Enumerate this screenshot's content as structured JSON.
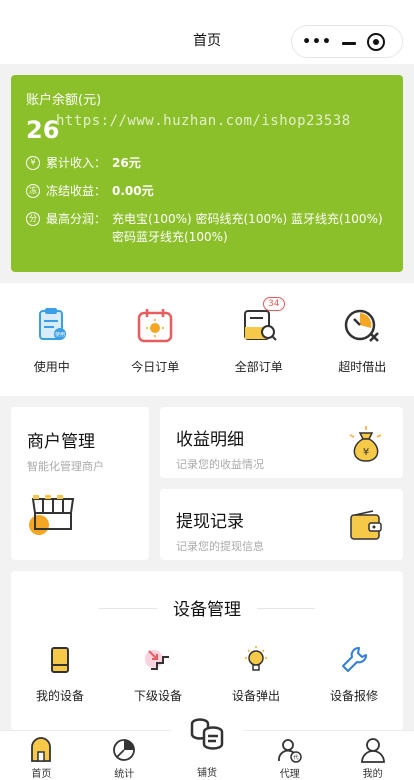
{
  "header": {
    "title": "首页"
  },
  "capsule": {
    "more_icon": "more-dots-icon",
    "minimize_icon": "minimize-icon",
    "close_icon": "target-close-icon"
  },
  "balance": {
    "label": "账户余额(元)",
    "amount": "26",
    "watermark": "https://www.huzhan.com/ishop23538",
    "rows": [
      {
        "icon": "yen-circle-icon",
        "key": "累计收入：",
        "value": "26元"
      },
      {
        "icon": "freeze-circle-icon",
        "key": "冻结收益：",
        "value": "0.00元"
      },
      {
        "icon": "share-circle-icon",
        "key": "最高分润：",
        "value": "充电宝(100%) 密码线充(100%) 蓝牙线充(100%) 密码蓝牙线充(100%)"
      }
    ],
    "color": "#8cc02a"
  },
  "orders": [
    {
      "label": "使用中",
      "icon": "clipboard-icon"
    },
    {
      "label": "今日订单",
      "icon": "calendar-icon"
    },
    {
      "label": "全部订单",
      "icon": "orders-search-icon",
      "badge": "34"
    },
    {
      "label": "超时借出",
      "icon": "clock-cancel-icon"
    }
  ],
  "merchant": {
    "title": "商户管理",
    "subtitle": "智能化管理商户",
    "icon": "shop-awning-icon"
  },
  "income": {
    "title": "收益明细",
    "subtitle": "记录您的收益情况",
    "icon": "money-bag-icon"
  },
  "withdraw": {
    "title": "提现记录",
    "subtitle": "记录您的提现信息",
    "icon": "wallet-icon"
  },
  "devices": {
    "title": "设备管理",
    "items": [
      {
        "label": "我的设备",
        "icon": "power-bank-icon"
      },
      {
        "label": "下级设备",
        "icon": "stairs-down-icon"
      },
      {
        "label": "设备弹出",
        "icon": "bulb-icon"
      },
      {
        "label": "设备报修",
        "icon": "wrench-icon"
      }
    ]
  },
  "tabbar": [
    {
      "label": "首页",
      "icon": "home-icon"
    },
    {
      "label": "统计",
      "icon": "pie-chart-icon"
    },
    {
      "label": "铺货",
      "icon": "distribute-icon"
    },
    {
      "label": "代理",
      "icon": "agent-icon"
    },
    {
      "label": "我的",
      "icon": "user-icon"
    }
  ]
}
